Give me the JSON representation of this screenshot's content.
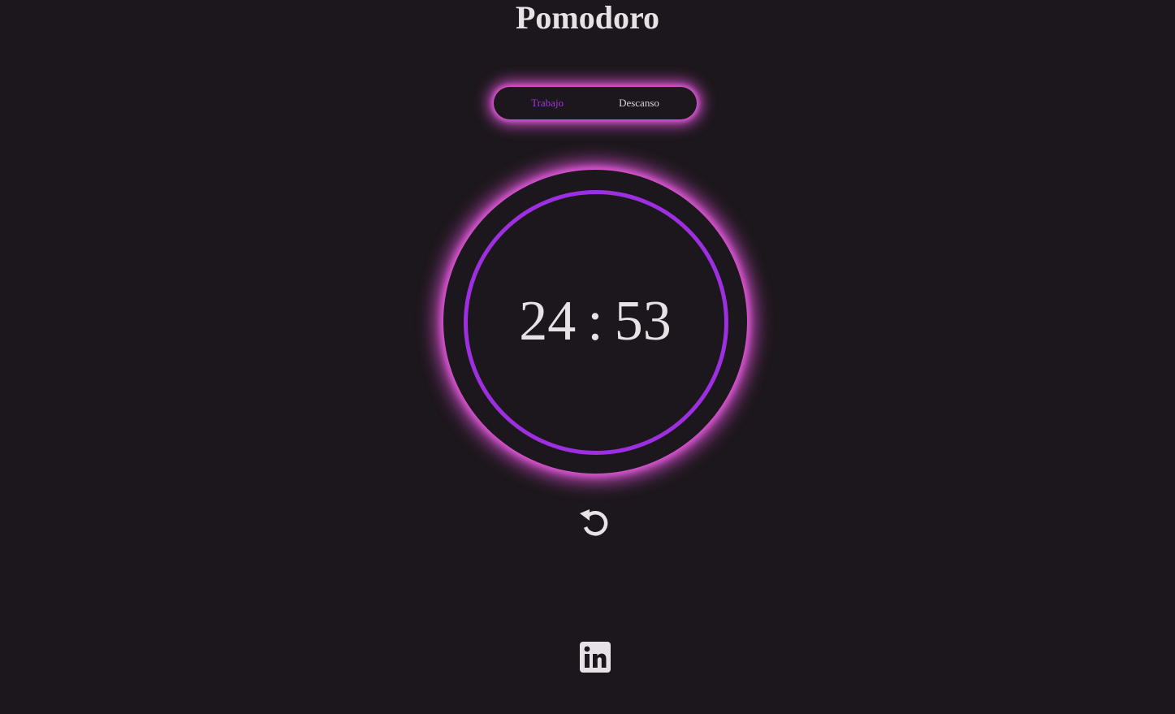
{
  "header": {
    "title": "Pomodoro"
  },
  "modes": {
    "work_label": "Trabajo",
    "break_label": "Descanso",
    "active": "work"
  },
  "timer": {
    "minutes": "24",
    "separator": ":",
    "seconds": "53"
  },
  "controls": {
    "reset_icon": "reset-icon"
  },
  "footer": {
    "social_icon": "linkedin-icon"
  },
  "colors": {
    "background": "#1c171c",
    "glow": "#d94fd2",
    "accent": "#9d2fe0",
    "text": "#e6e2e6"
  }
}
